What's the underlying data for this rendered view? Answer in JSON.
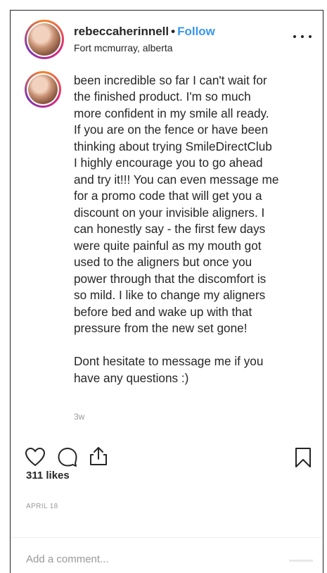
{
  "header": {
    "username": "rebeccaherinnell",
    "separator": "•",
    "follow_label": "Follow",
    "location": "Fort mcmurray, alberta",
    "more_icon": "more-horizontal-icon"
  },
  "caption": {
    "cut_line": "been incredible so far I can't wait for",
    "text": "the finished product. I'm so much\nmore confident in my smile all ready.\nIf you are on the fence or have been\nthinking about trying SmileDirectClub\nI highly encourage you to go ahead\nand try it!!! You can even message me\nfor a promo code that will get you a\ndiscount on your invisible aligners. I\ncan honestly say - the first few days\nwere quite painful as my mouth got\nused to the aligners but once you\npower through that the discomfort is\nso mild. I like to change my aligners\nbefore bed and wake up with that\npressure from the new set gone!\n\nDont hesitate to message me if you\nhave any questions :)",
    "timestamp": "3w"
  },
  "actions": {
    "icons": [
      "heart-icon",
      "comment-icon",
      "share-icon",
      "bookmark-icon"
    ]
  },
  "likes": "311 likes",
  "post_date": "APRIL 18",
  "comment": {
    "placeholder": "Add a comment..."
  },
  "colors": {
    "link_blue": "#3897f0",
    "text": "#262626",
    "muted": "#999999"
  }
}
